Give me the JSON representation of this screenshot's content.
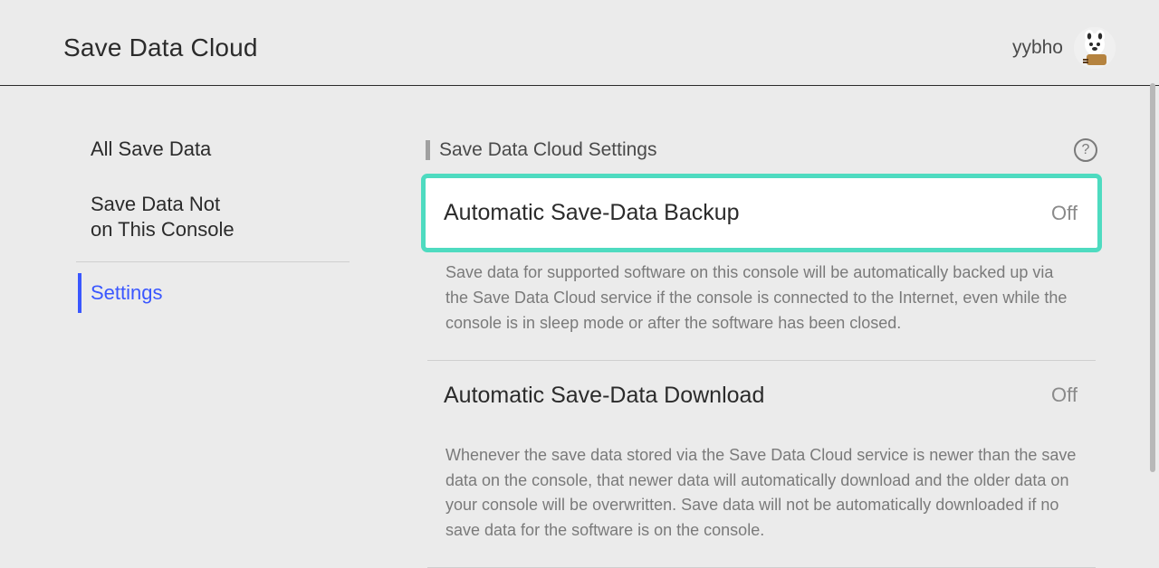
{
  "header": {
    "title": "Save Data Cloud",
    "username": "yybho"
  },
  "sidebar": {
    "items": [
      {
        "label": "All Save Data",
        "active": false
      },
      {
        "label": "Save Data Not\non This Console",
        "active": false
      },
      {
        "label": "Settings",
        "active": true
      }
    ]
  },
  "main": {
    "section_title": "Save Data Cloud Settings",
    "help_glyph": "?",
    "settings": [
      {
        "label": "Automatic Save-Data Backup",
        "value": "Off",
        "focused": true,
        "description": "Save data for supported software on this console will be automatically backed up via the Save Data Cloud service if the console is connected to the Internet, even while the console is in sleep mode or after the software has been closed."
      },
      {
        "label": "Automatic Save-Data Download",
        "value": "Off",
        "focused": false,
        "description": "Whenever the save data stored via the Save Data Cloud service is newer than the save data on the console, that newer data will automatically download and the older data on your console will be overwritten. Save data will not be automatically downloaded if no save data for the software is on the console."
      }
    ]
  }
}
